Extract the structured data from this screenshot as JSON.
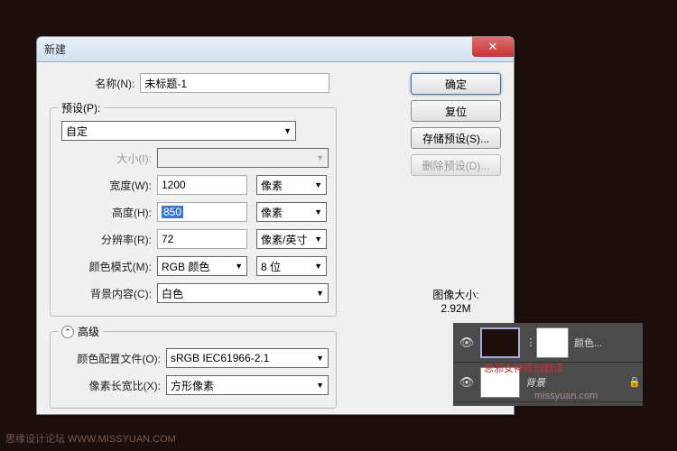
{
  "dialog": {
    "title": "新建",
    "name_label": "名称(N):",
    "name_value": "未标题-1",
    "preset_legend": "预设(P):",
    "preset_value": "自定",
    "size_label": "大小(I):",
    "width_label": "宽度(W):",
    "width_value": "1200",
    "width_unit": "像素",
    "height_label": "高度(H):",
    "height_value": "850",
    "height_unit": "像素",
    "res_label": "分辨率(R):",
    "res_value": "72",
    "res_unit": "像素/英寸",
    "mode_label": "颜色模式(M):",
    "mode_value": "RGB 颜色",
    "mode_depth": "8 位",
    "bg_label": "背景内容(C):",
    "bg_value": "白色",
    "adv_legend": "高级",
    "profile_label": "颜色配置文件(O):",
    "profile_value": "sRGB IEC61966-2.1",
    "aspect_label": "像素长宽比(X):",
    "aspect_value": "方形像素",
    "btn_ok": "确定",
    "btn_reset": "复位",
    "btn_save_preset": "存储预设(S)...",
    "btn_del_preset": "删除预设(D)...",
    "imgsize_label": "图像大小:",
    "imgsize_value": "2.92M"
  },
  "layers": {
    "row1_label": "颜色...",
    "row2_label": "背景",
    "overlay1": "思邪女神原创翻译",
    "overlay2": "missyuan.com"
  },
  "watermark": "思缘设计论坛   WWW.MISSYUAN.COM"
}
